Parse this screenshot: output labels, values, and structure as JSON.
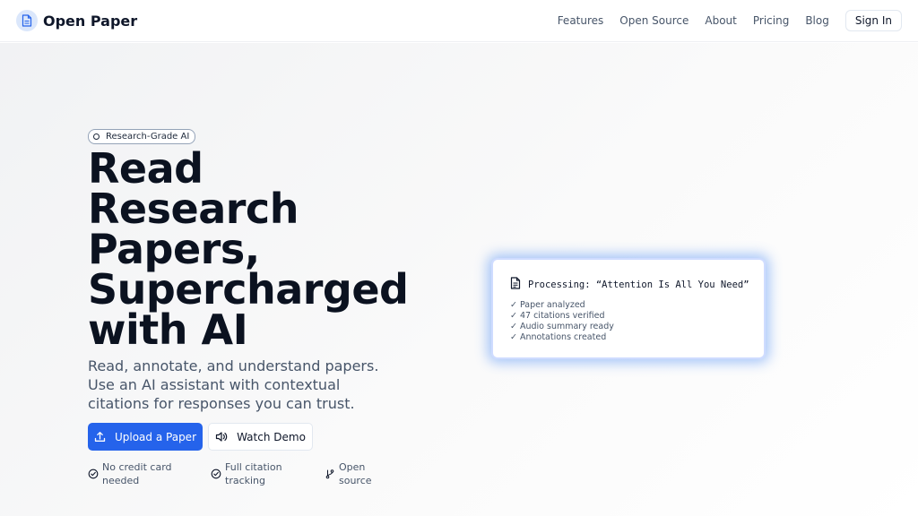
{
  "header": {
    "brand_name": "Open Paper",
    "brand_icon": "document-icon",
    "nav": [
      "Features",
      "Open Source",
      "About",
      "Pricing",
      "Blog"
    ],
    "signin_label": "Sign In"
  },
  "hero": {
    "badge": "Research-Grade AI",
    "headline": [
      "Read",
      "Research",
      "Papers,",
      "Supercharged",
      "with AI"
    ],
    "subtext": "Read, annotate, and understand papers. Use an AI assistant with contextual citations for responses you can trust.",
    "upload_label": "Upload a Paper",
    "demo_label": "Watch Demo",
    "features": [
      {
        "icon": "check-circle-icon",
        "lines": [
          "No credit card",
          "needed"
        ]
      },
      {
        "icon": "check-circle-icon",
        "lines": [
          "Full citation",
          "tracking"
        ]
      },
      {
        "icon": "git-branch-icon",
        "lines": [
          "Open",
          "source"
        ]
      }
    ]
  },
  "card": {
    "title": "Processing: “Attention Is All You Need”",
    "items": [
      "✓ Paper analyzed",
      "✓ 47 citations verified",
      "✓ Audio summary ready",
      "✓ Annotations created"
    ]
  },
  "colors": {
    "accent": "#2563eb",
    "card_glow": "#3b82f6",
    "heading": "#0b1220",
    "muted": "#475569"
  }
}
